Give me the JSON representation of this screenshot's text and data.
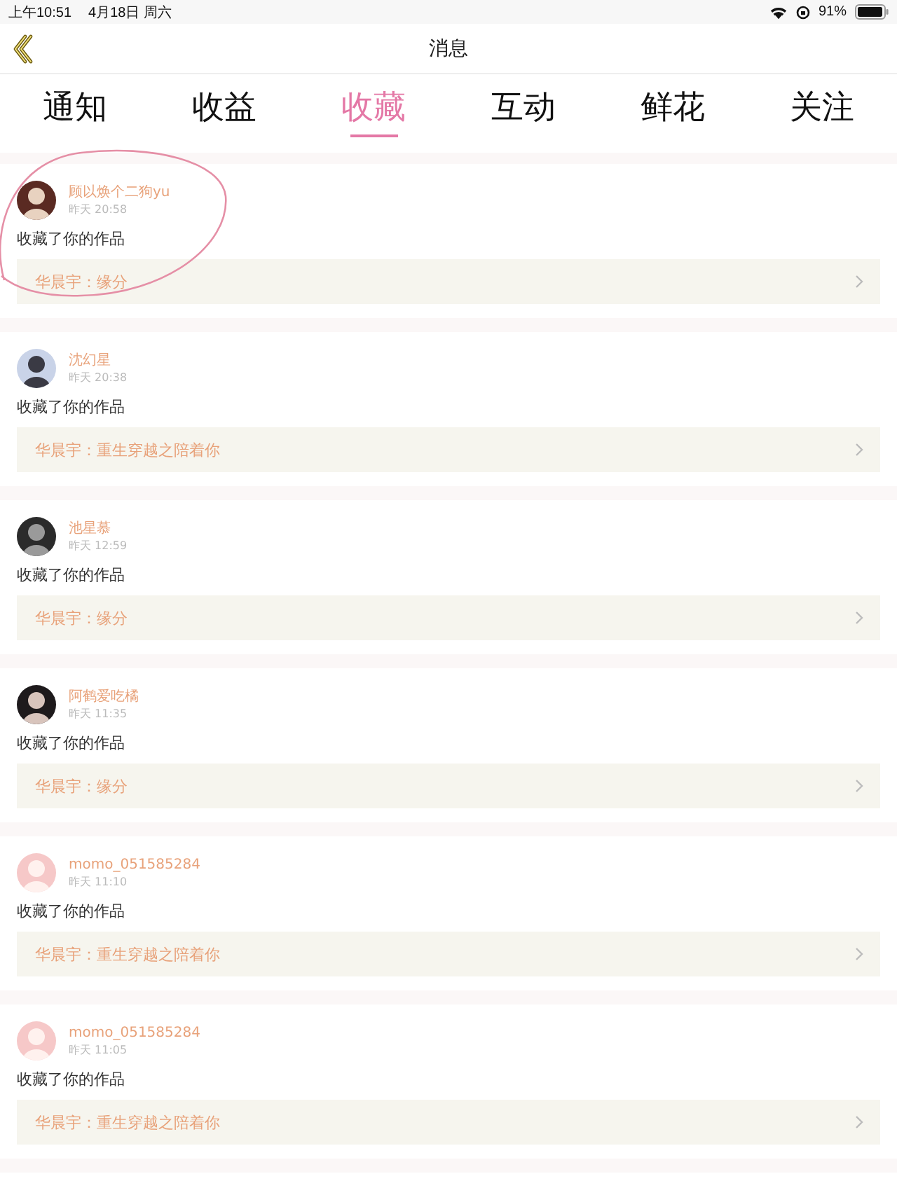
{
  "status_bar": {
    "time": "上午10:51",
    "date": "4月18日 周六",
    "battery": "91%"
  },
  "nav": {
    "title": "消息"
  },
  "tabs": [
    {
      "label": "通知",
      "selected": false
    },
    {
      "label": "收益",
      "selected": false
    },
    {
      "label": "收藏",
      "selected": true
    },
    {
      "label": "互动",
      "selected": false
    },
    {
      "label": "鲜花",
      "selected": false
    },
    {
      "label": "关注",
      "selected": false
    }
  ],
  "items": [
    {
      "user": "顾以焕个二狗yu",
      "time": "昨天 20:58",
      "action": "收藏了你的作品",
      "work": "华晨宇：缘分",
      "circled": true
    },
    {
      "user": "沈幻星",
      "time": "昨天 20:38",
      "action": "收藏了你的作品",
      "work": "华晨宇：重生穿越之陪着你",
      "circled": false
    },
    {
      "user": "池星慕",
      "time": "昨天 12:59",
      "action": "收藏了你的作品",
      "work": "华晨宇：缘分",
      "circled": false
    },
    {
      "user": "阿鹤爱吃橘",
      "time": "昨天 11:35",
      "action": "收藏了你的作品",
      "work": "华晨宇：缘分",
      "circled": false
    },
    {
      "user": "momo_051585284",
      "time": "昨天 11:10",
      "action": "收藏了你的作品",
      "work": "华晨宇：重生穿越之陪着你",
      "circled": false
    },
    {
      "user": "momo_051585284",
      "time": "昨天 11:05",
      "action": "收藏了你的作品",
      "work": "华晨宇：重生穿越之陪着你",
      "circled": false
    }
  ]
}
